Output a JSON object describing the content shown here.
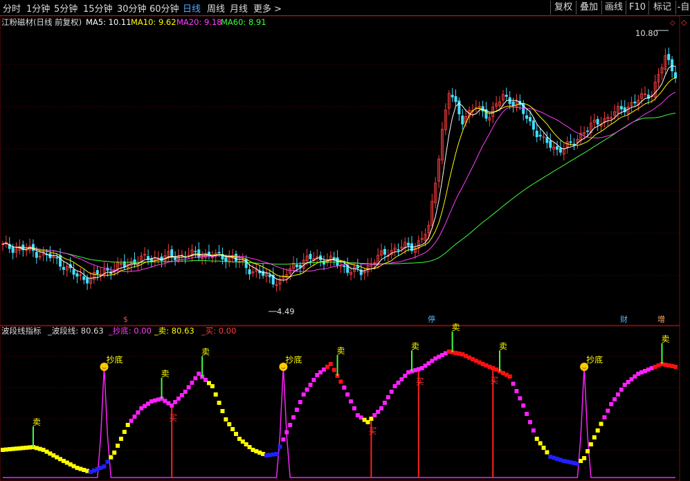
{
  "toolbar": {
    "periods": [
      "分时",
      "1分钟",
      "5分钟",
      "15分钟",
      "30分钟",
      "60分钟",
      "日线",
      "周线",
      "月线",
      "更多 >"
    ],
    "active_period": "日线",
    "tools": [
      "复权",
      "叠加",
      "画线",
      "F10",
      "标记",
      "-自"
    ]
  },
  "price_legend": {
    "title": "江粉磁材(日线 前复权)",
    "ma5": "MA5: 10.11",
    "ma10": "MA10: 9.62",
    "ma20": "MA20: 9.18",
    "ma60": "MA60: 8.91"
  },
  "price_annotations": {
    "high": "10.80",
    "low": "4.49"
  },
  "event_flags": [
    {
      "label": "$",
      "color": "#ff4040"
    },
    {
      "label": "停",
      "color": "#55b8ff"
    },
    {
      "label": "财",
      "color": "#55b8ff"
    },
    {
      "label": "增",
      "color": "#ffaa66"
    }
  ],
  "indicator_legend": {
    "name": "波段线指标",
    "line": "_波段线: 80.63",
    "bottom": "_抄底: 0.00",
    "sell": "_卖: 80.63",
    "buy": "_买: 0.00"
  },
  "signal_labels": {
    "sell": "卖",
    "buy": "买",
    "bottom": "抄底"
  },
  "colors": {
    "ma5": "#ffffff",
    "ma10": "#ffff00",
    "ma20": "#ff40ff",
    "ma60": "#40ff40",
    "up": "#ff4040",
    "down": "#40e0ff",
    "buy_line": "#ff2020",
    "sell_flag": "#40ff40",
    "band_yellow": "#ffff00",
    "band_blue": "#2020ff",
    "band_magenta": "#ff20ff",
    "band_red": "#ff1010"
  },
  "chart_data": [
    {
      "type": "candlestick",
      "title": "江粉磁材(日线 前复权)",
      "series": [
        {
          "name": "MA5",
          "value": 10.11
        },
        {
          "name": "MA10",
          "value": 9.62
        },
        {
          "name": "MA20",
          "value": 9.18
        },
        {
          "name": "MA60",
          "value": 8.91
        }
      ],
      "annotations": {
        "max_price": 10.8,
        "min_price": 4.49
      }
    },
    {
      "type": "line",
      "title": "波段线指标",
      "series": [
        {
          "name": "_波段线",
          "value": 80.63
        },
        {
          "name": "_抄底",
          "value": 0.0
        },
        {
          "name": "_卖",
          "value": 80.63
        },
        {
          "name": "_买",
          "value": 0.0
        }
      ],
      "ylim": [
        0,
        100
      ],
      "x_index_range": [
        0,
        199
      ],
      "band_keypoints": [
        [
          0,
          20
        ],
        [
          9,
          22
        ],
        [
          12,
          20
        ],
        [
          18,
          12
        ],
        [
          22,
          7
        ],
        [
          26,
          4
        ],
        [
          30,
          8
        ],
        [
          33,
          18
        ],
        [
          37,
          38
        ],
        [
          41,
          50
        ],
        [
          44,
          55
        ],
        [
          47,
          57
        ],
        [
          50,
          52
        ],
        [
          54,
          62
        ],
        [
          58,
          75
        ],
        [
          62,
          66
        ],
        [
          66,
          42
        ],
        [
          70,
          28
        ],
        [
          74,
          20
        ],
        [
          78,
          16
        ],
        [
          81,
          17
        ],
        [
          85,
          38
        ],
        [
          89,
          60
        ],
        [
          93,
          74
        ],
        [
          97,
          82
        ],
        [
          101,
          65
        ],
        [
          105,
          45
        ],
        [
          108,
          40
        ],
        [
          112,
          50
        ],
        [
          116,
          66
        ],
        [
          120,
          76
        ],
        [
          124,
          79
        ],
        [
          128,
          86
        ],
        [
          132,
          91
        ],
        [
          136,
          89
        ],
        [
          142,
          82
        ],
        [
          146,
          78
        ],
        [
          150,
          73
        ],
        [
          154,
          52
        ],
        [
          158,
          28
        ],
        [
          162,
          15
        ],
        [
          166,
          12
        ],
        [
          170,
          10
        ],
        [
          172,
          14
        ],
        [
          176,
          34
        ],
        [
          180,
          53
        ],
        [
          184,
          67
        ],
        [
          188,
          75
        ],
        [
          192,
          79
        ],
        [
          195,
          82
        ],
        [
          199,
          80
        ]
      ],
      "band_states": [
        [
          0,
          25,
          "yellow"
        ],
        [
          26,
          31,
          "blue"
        ],
        [
          32,
          37,
          "yellow"
        ],
        [
          38,
          54,
          "magenta"
        ],
        [
          55,
          60,
          "magenta"
        ],
        [
          61,
          77,
          "yellow"
        ],
        [
          78,
          82,
          "blue"
        ],
        [
          83,
          95,
          "magenta"
        ],
        [
          96,
          100,
          "red"
        ],
        [
          101,
          106,
          "magenta"
        ],
        [
          107,
          109,
          "yellow"
        ],
        [
          110,
          131,
          "magenta"
        ],
        [
          132,
          150,
          "red"
        ],
        [
          151,
          157,
          "magenta"
        ],
        [
          158,
          161,
          "yellow"
        ],
        [
          162,
          170,
          "blue"
        ],
        [
          171,
          177,
          "yellow"
        ],
        [
          178,
          192,
          "magenta"
        ],
        [
          193,
          199,
          "red"
        ]
      ],
      "sell_signals": [
        9,
        47,
        59,
        99,
        121,
        133,
        147,
        195
      ],
      "buy_signals": [
        50,
        109,
        123,
        145
      ],
      "bottom_signals": [
        30,
        83,
        172
      ],
      "buy_line_x": [
        50,
        109,
        123,
        145
      ]
    }
  ]
}
